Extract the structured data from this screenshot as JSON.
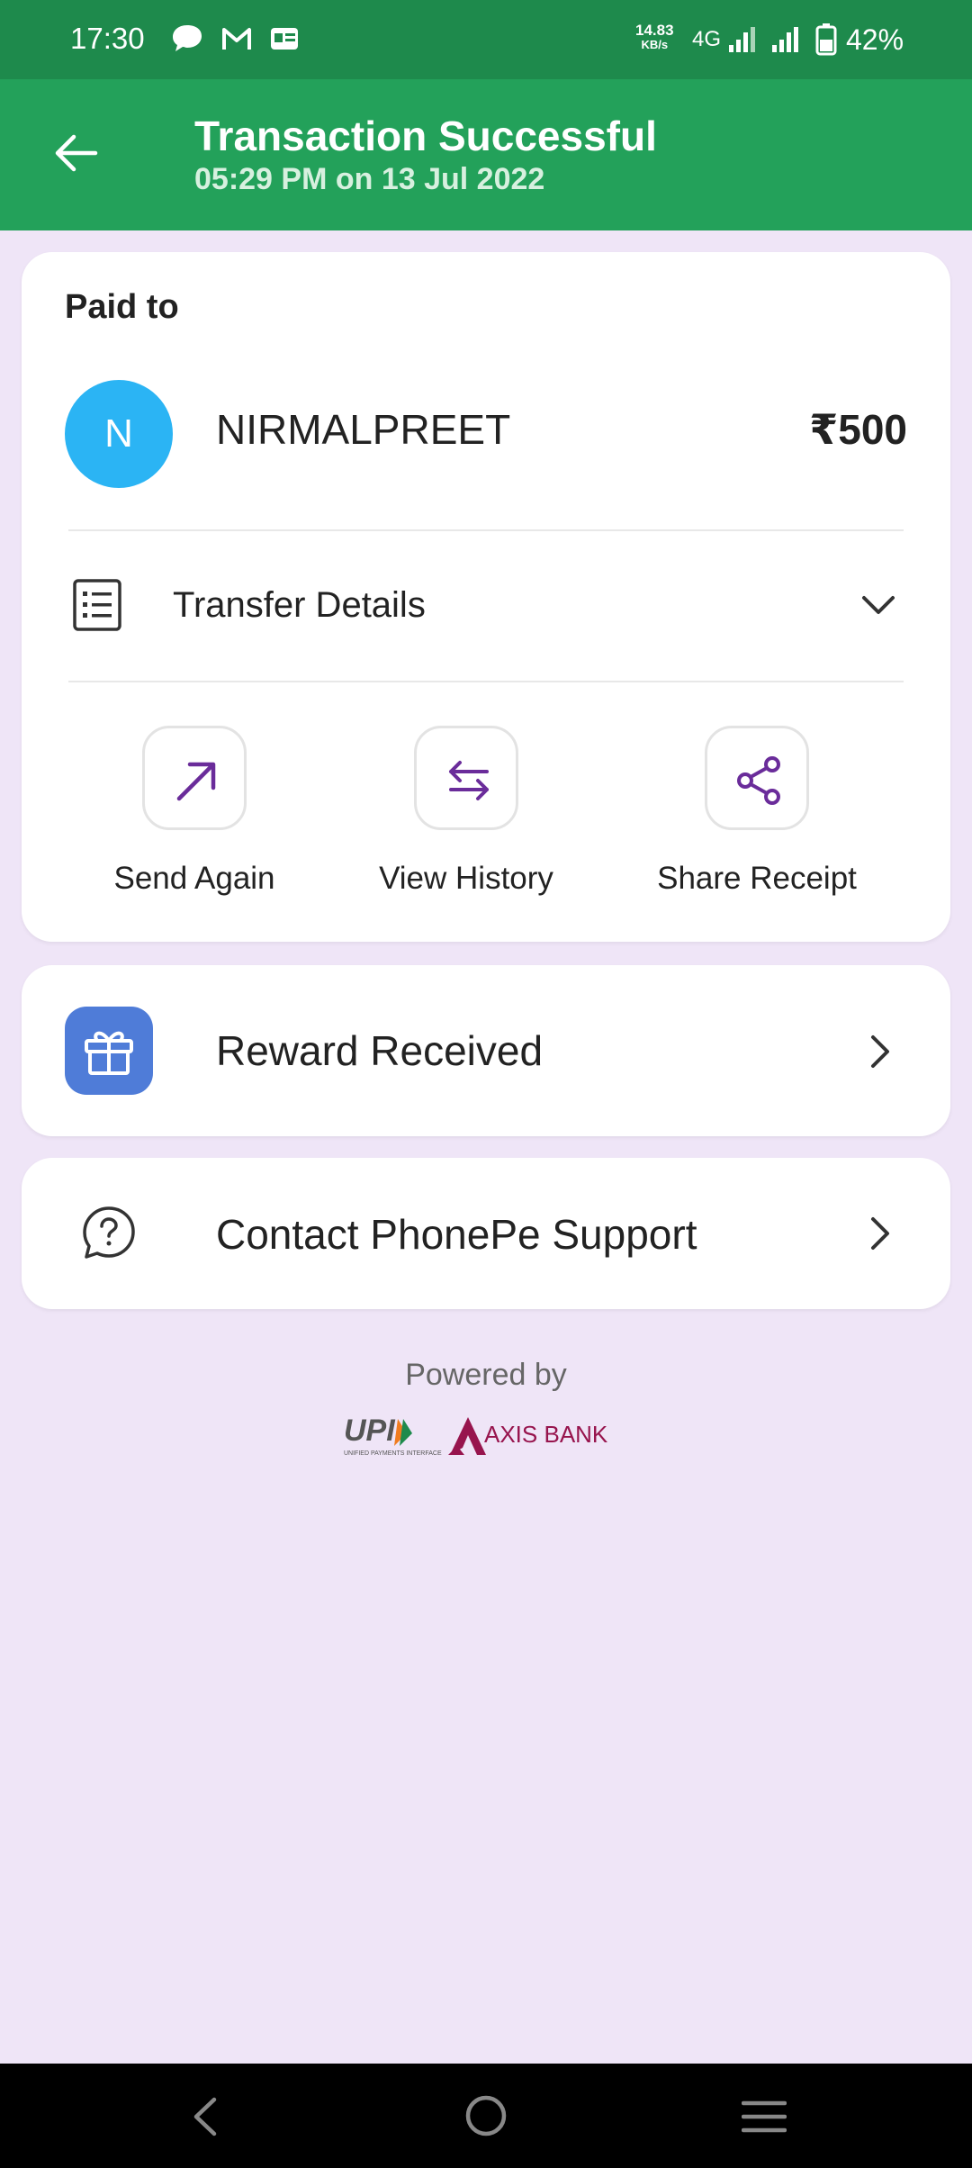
{
  "status_bar": {
    "time": "17:30",
    "net_speed_value": "14.83",
    "net_speed_unit": "KB/s",
    "network": "4G",
    "battery": "42%",
    "icons": [
      "message-icon",
      "gmail-icon",
      "news-icon",
      "signal-icon",
      "battery-icon"
    ]
  },
  "header": {
    "title": "Transaction Successful",
    "subtitle": "05:29 PM on 13 Jul 2022"
  },
  "payment": {
    "paid_to_label": "Paid to",
    "avatar_initial": "N",
    "payee_name": "NIRMALPREET",
    "amount": "₹500",
    "transfer_details_label": "Transfer Details"
  },
  "actions": [
    {
      "label": "Send Again",
      "icon": "send-arrow-icon"
    },
    {
      "label": "View History",
      "icon": "swap-arrows-icon"
    },
    {
      "label": "Share Receipt",
      "icon": "share-icon"
    }
  ],
  "reward": {
    "label": "Reward Received",
    "icon": "gift-icon"
  },
  "support": {
    "label": "Contact PhonePe Support",
    "icon": "help-icon"
  },
  "footer": {
    "powered_by": "Powered by",
    "upi_logo_text": "UPI",
    "upi_logo_subtext": "UNIFIED PAYMENTS INTERFACE",
    "bank_logo_text": "AXIS BANK"
  },
  "colors": {
    "status_bar": "#1e8a4c",
    "app_bar": "#23a15a",
    "background": "#efe5f7",
    "accent_purple": "#6a2c9a",
    "avatar_blue": "#2bb4f4",
    "gift_blue": "#4f7cd8",
    "axis_maroon": "#97144d"
  }
}
